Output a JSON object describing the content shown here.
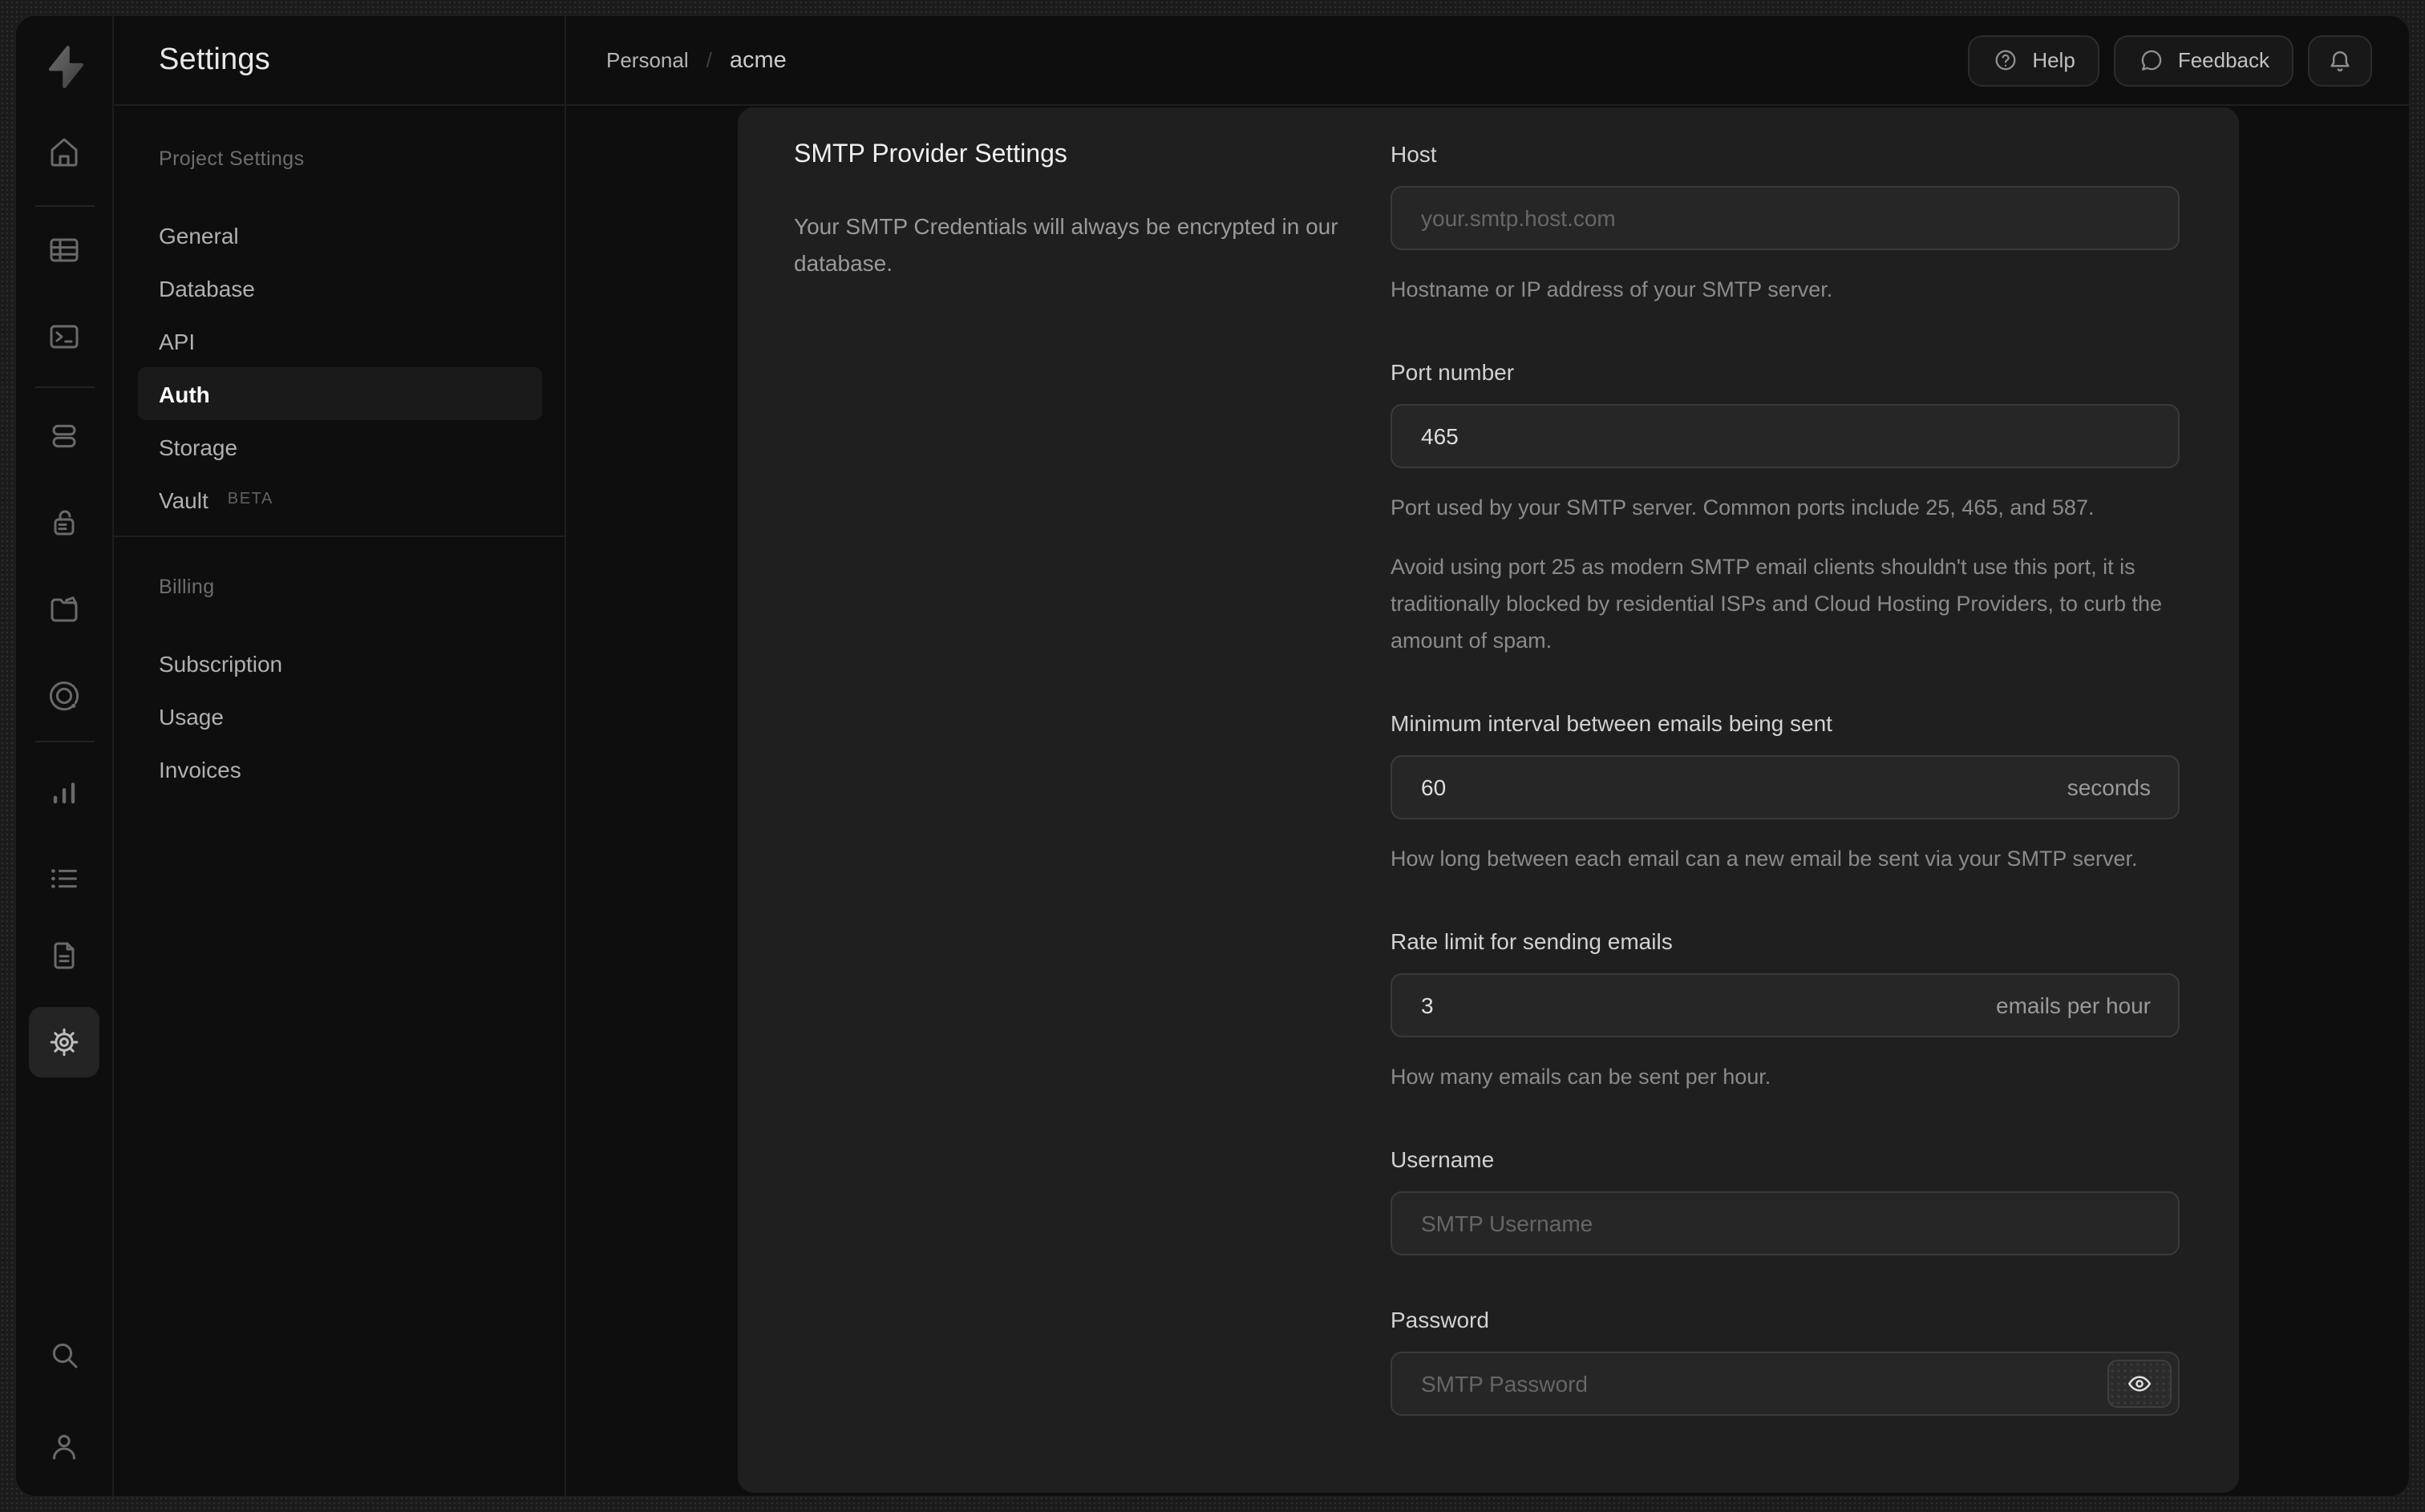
{
  "app": {
    "name": "Supabase dashboard"
  },
  "colors": {
    "backdrop": "#1b1b1b",
    "surface": "#0e0e0e",
    "card": "#1f1f1f",
    "input_bg": "#262626",
    "input_border": "#3a3a3a",
    "text_primary": "#f0f0f0",
    "text_secondary": "#9a9a9a",
    "text_muted": "#6d6d6d"
  },
  "rail": {
    "items": [
      "home",
      "table-editor",
      "sql-editor",
      "database",
      "auth",
      "storage",
      "edge-functions",
      "reports",
      "logs",
      "docs",
      "settings"
    ],
    "active": "settings",
    "footer": [
      "search",
      "user"
    ]
  },
  "nav": {
    "title": "Settings",
    "sections": [
      {
        "label": "Project Settings",
        "items": [
          {
            "label": "General"
          },
          {
            "label": "Database"
          },
          {
            "label": "API"
          },
          {
            "label": "Auth",
            "active": true
          },
          {
            "label": "Storage"
          },
          {
            "label": "Vault",
            "badge": "BETA"
          }
        ]
      },
      {
        "label": "Billing",
        "items": [
          {
            "label": "Subscription"
          },
          {
            "label": "Usage"
          },
          {
            "label": "Invoices"
          }
        ]
      }
    ]
  },
  "header": {
    "breadcrumb": {
      "org": "Personal",
      "separator": "/",
      "project": "acme"
    },
    "help_label": "Help",
    "feedback_label": "Feedback"
  },
  "panel": {
    "title": "SMTP Provider Settings",
    "description": "Your SMTP Credentials will always be encrypted in our database.",
    "fields": [
      {
        "label": "Host",
        "placeholder": "your.smtp.host.com",
        "help": [
          "Hostname or IP address of your SMTP server."
        ]
      },
      {
        "label": "Port number",
        "value": "465",
        "help": [
          "Port used by your SMTP server. Common ports include 25, 465, and 587.",
          "Avoid using port 25 as modern SMTP email clients shouldn't use this port, it is traditionally blocked by residential ISPs and Cloud Hosting Providers, to curb the amount of spam."
        ]
      },
      {
        "label": "Minimum interval between emails being sent",
        "value": "60",
        "suffix": "seconds",
        "help": [
          "How long between each email can a new email be sent via your SMTP server."
        ]
      },
      {
        "label": "Rate limit for sending emails",
        "value": "3",
        "suffix": "emails per hour",
        "help": [
          "How many emails can be sent per hour."
        ]
      },
      {
        "label": "Username",
        "placeholder": "SMTP Username"
      },
      {
        "label": "Password",
        "placeholder": "SMTP Password"
      }
    ]
  }
}
